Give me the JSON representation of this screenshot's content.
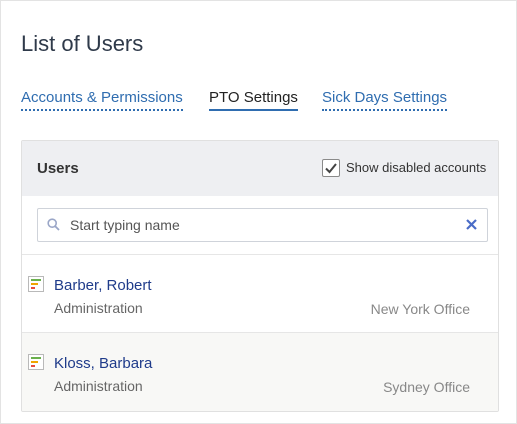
{
  "page": {
    "title": "List of Users"
  },
  "tabs": [
    {
      "label": "Accounts & Permissions",
      "active": false
    },
    {
      "label": "PTO Settings",
      "active": true
    },
    {
      "label": "Sick Days Settings",
      "active": false
    }
  ],
  "panel": {
    "title": "Users",
    "show_disabled": {
      "label": "Show disabled accounts",
      "checked": true
    },
    "search": {
      "placeholder": "Start typing name",
      "value": ""
    }
  },
  "users": [
    {
      "name": "Barber, Robert",
      "department": "Administration",
      "office": "New York Office"
    },
    {
      "name": "Kloss, Barbara",
      "department": "Administration",
      "office": "Sydney Office"
    }
  ],
  "icons": {
    "user_icon": "org-chart-icon",
    "search": "search-icon",
    "clear": "close-icon",
    "checkbox": "check-icon"
  },
  "colors": {
    "link": "#2f6db0",
    "user_name": "#1f3b8a",
    "clear": "#4a6cc7",
    "header_bg": "#eeeff2"
  }
}
